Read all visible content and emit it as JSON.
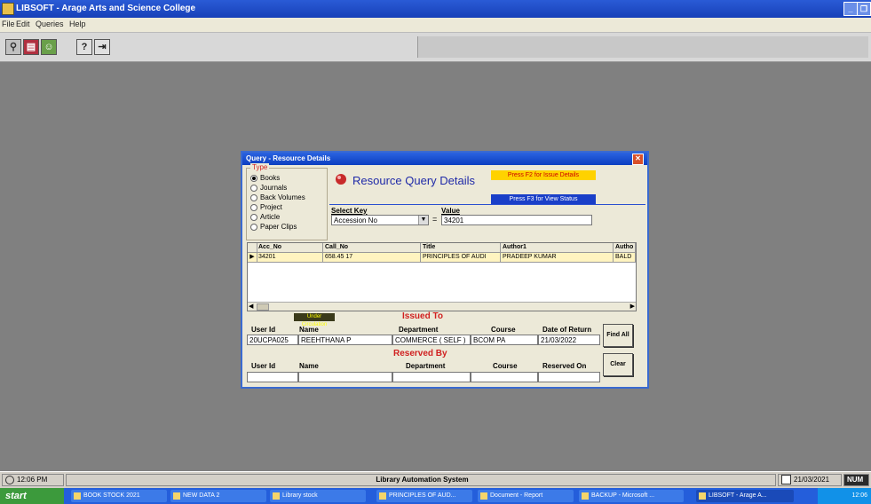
{
  "window": {
    "title": "LIBSOFT - Arage Arts and Science College"
  },
  "menu": [
    "File",
    "Edit",
    "Queries",
    "Help"
  ],
  "dialog": {
    "title": "Query - Resource Details",
    "header": "Resource Query Details",
    "f2_label": "Press F2 for Issue Details",
    "f3_label": "Press F3 for View Status",
    "types_legend": "Type",
    "types": [
      "Books",
      "Journals",
      "Back Volumes",
      "Project",
      "Article",
      "Paper Clips"
    ],
    "selected_type": "Books",
    "select_key_label": "Select Key",
    "select_key_value": "Accession No",
    "value_label": "Value",
    "value_text": "34201",
    "grid_columns": [
      "Acc_No",
      "Call_No",
      "Title",
      "Author1",
      "Autho"
    ],
    "grid_row": [
      "34201",
      "658.45 17",
      "PRINCIPLES OF AUDI",
      "PRADEEP KUMAR",
      "BALD"
    ],
    "due_badge": "Under Circulation",
    "issued_to": {
      "heading": "Issued To",
      "labels": [
        "User Id",
        "Name",
        "Department",
        "Course",
        "Date of Return"
      ],
      "values": [
        "20UCPA025",
        "REEHTHANA P",
        "COMMERCE ( SELF )",
        "BCOM PA",
        "21/03/2022"
      ]
    },
    "reserved_by": {
      "heading": "Reserved By",
      "labels": [
        "User Id",
        "Name",
        "Department",
        "Course",
        "Reserved On"
      ]
    },
    "buttons": {
      "find_all": "Find All",
      "clear": "Clear"
    }
  },
  "statusbar": {
    "time": "12:06 PM",
    "app_name": "Library Automation System",
    "date": "21/03/2021",
    "mode": "NUM"
  },
  "taskbar": {
    "start": "start",
    "tasks": [
      "BOOK STOCK 2021",
      "NEW DATA 2",
      "Library stock",
      "PRINCIPLES OF AUD...",
      "Document - Report",
      "BACKUP - Microsoft ...",
      "LIBSOFT - Arage A..."
    ],
    "tray_time": "12:06"
  }
}
